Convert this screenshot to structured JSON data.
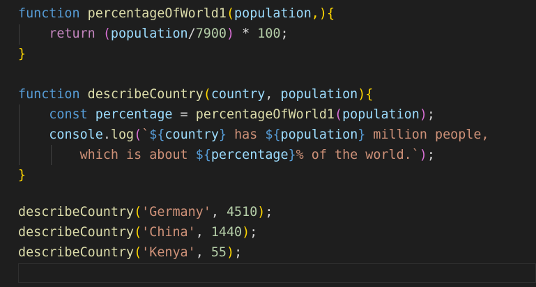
{
  "editor": {
    "lines": [
      {
        "tokens": [
          "function",
          "percentageOfWorld1",
          "(",
          "population",
          ",)",
          "{"
        ]
      },
      {
        "tokens": [
          "return",
          "(",
          "population",
          "/",
          "7900",
          ")",
          " * ",
          "100",
          ";"
        ]
      },
      {
        "tokens": [
          "}"
        ]
      },
      {
        "tokens": []
      },
      {
        "tokens": [
          "function",
          "describeCountry",
          "(",
          "country",
          ", ",
          "population",
          ")",
          "{"
        ]
      },
      {
        "tokens": [
          "const",
          "percentage",
          " = ",
          "percentageOfWorld1",
          "(",
          "population",
          ")",
          ";"
        ]
      },
      {
        "tokens": [
          "console",
          ".",
          "log",
          "(",
          "`",
          "${",
          "country",
          "}",
          " has ",
          "${",
          "population",
          "}",
          " million people,"
        ]
      },
      {
        "tokens": [
          "which is about ",
          "${",
          "percentage",
          "}",
          "% of the world.`",
          ")",
          ";"
        ]
      },
      {
        "tokens": [
          "}"
        ]
      },
      {
        "tokens": []
      },
      {
        "tokens": [
          "describeCountry",
          "(",
          "'Germany'",
          ", ",
          "4510",
          ")",
          ";"
        ]
      },
      {
        "tokens": [
          "describeCountry",
          "(",
          "'China'",
          ", ",
          "1440",
          ")",
          ";"
        ]
      },
      {
        "tokens": [
          "describeCountry",
          "(",
          "'Kenya'",
          ", ",
          "55",
          ")",
          ";"
        ]
      }
    ]
  },
  "colors": {
    "background": "#1e1e1e",
    "keyword": "#569cd6",
    "control": "#c586c0",
    "function": "#dcdcaa",
    "variable": "#9cdcfe",
    "string": "#ce9178",
    "number": "#b5cea8"
  }
}
